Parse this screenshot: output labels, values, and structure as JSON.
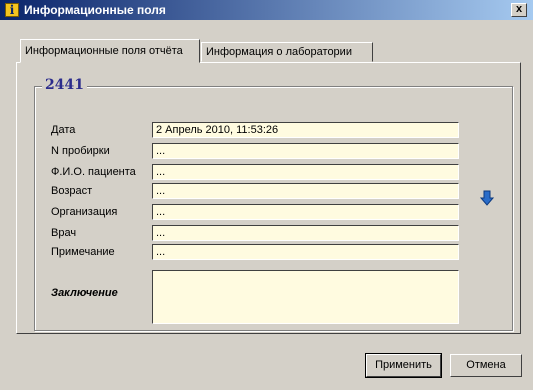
{
  "window": {
    "title": "Информационные поля",
    "close_label": "x"
  },
  "tabs": [
    {
      "label": "Информационные поля отчёта",
      "active": true
    },
    {
      "label": "Информация о лаборатории",
      "active": false
    }
  ],
  "group": {
    "title": "2441"
  },
  "fields": [
    {
      "label": "Дата",
      "value": "2 Апрель 2010, 11:53:26"
    },
    {
      "label": "N пробирки",
      "value": "..."
    },
    {
      "label": "Ф.И.О. пациента",
      "value": "..."
    },
    {
      "label": "Возраст",
      "value": "..."
    },
    {
      "label": "Организация",
      "value": "..."
    },
    {
      "label": "Врач",
      "value": "..."
    },
    {
      "label": "Примечание",
      "value": "..."
    }
  ],
  "conclusion": {
    "label": "Заключение",
    "value": ""
  },
  "icons": {
    "window_icon": "info-icon",
    "side_button": "arrow-down-icon"
  },
  "buttons": {
    "apply": "Применить",
    "cancel": "Отмена"
  },
  "colors": {
    "titlebar": "#0a246a",
    "field_bg": "#fffbe0",
    "group_title": "#2c2c8c",
    "arrow": "#2a6cc8"
  }
}
